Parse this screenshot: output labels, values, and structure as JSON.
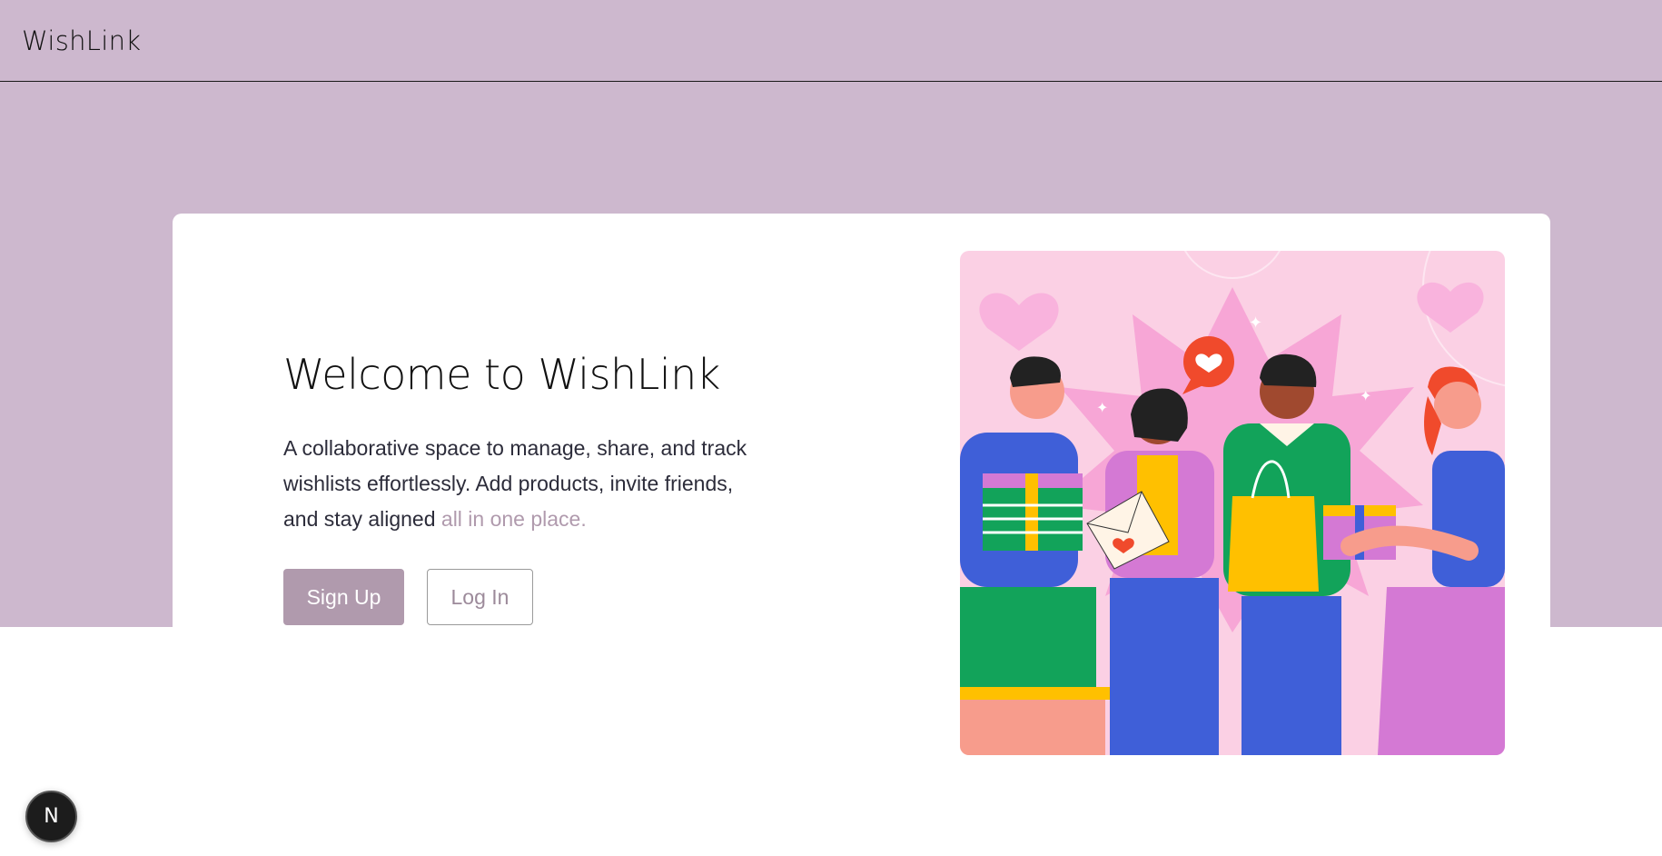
{
  "header": {
    "brand": "WishLink"
  },
  "hero": {
    "title": "Welcome to WishLink",
    "description": "A collaborative space to manage, share, and track wishlists effortlessly. Add products, invite friends, and stay aligned",
    "description_accent": "all in one place.",
    "signup_label": "Sign Up",
    "login_label": "Log In"
  },
  "dev_badge": {
    "label": "N"
  },
  "colors": {
    "background": "#cdb8ce",
    "accent": "#b09aad",
    "card": "#ffffff",
    "illustration_bg": "#fbd0e4"
  },
  "illustration": {
    "icon": "friends-gifts-illustration"
  }
}
